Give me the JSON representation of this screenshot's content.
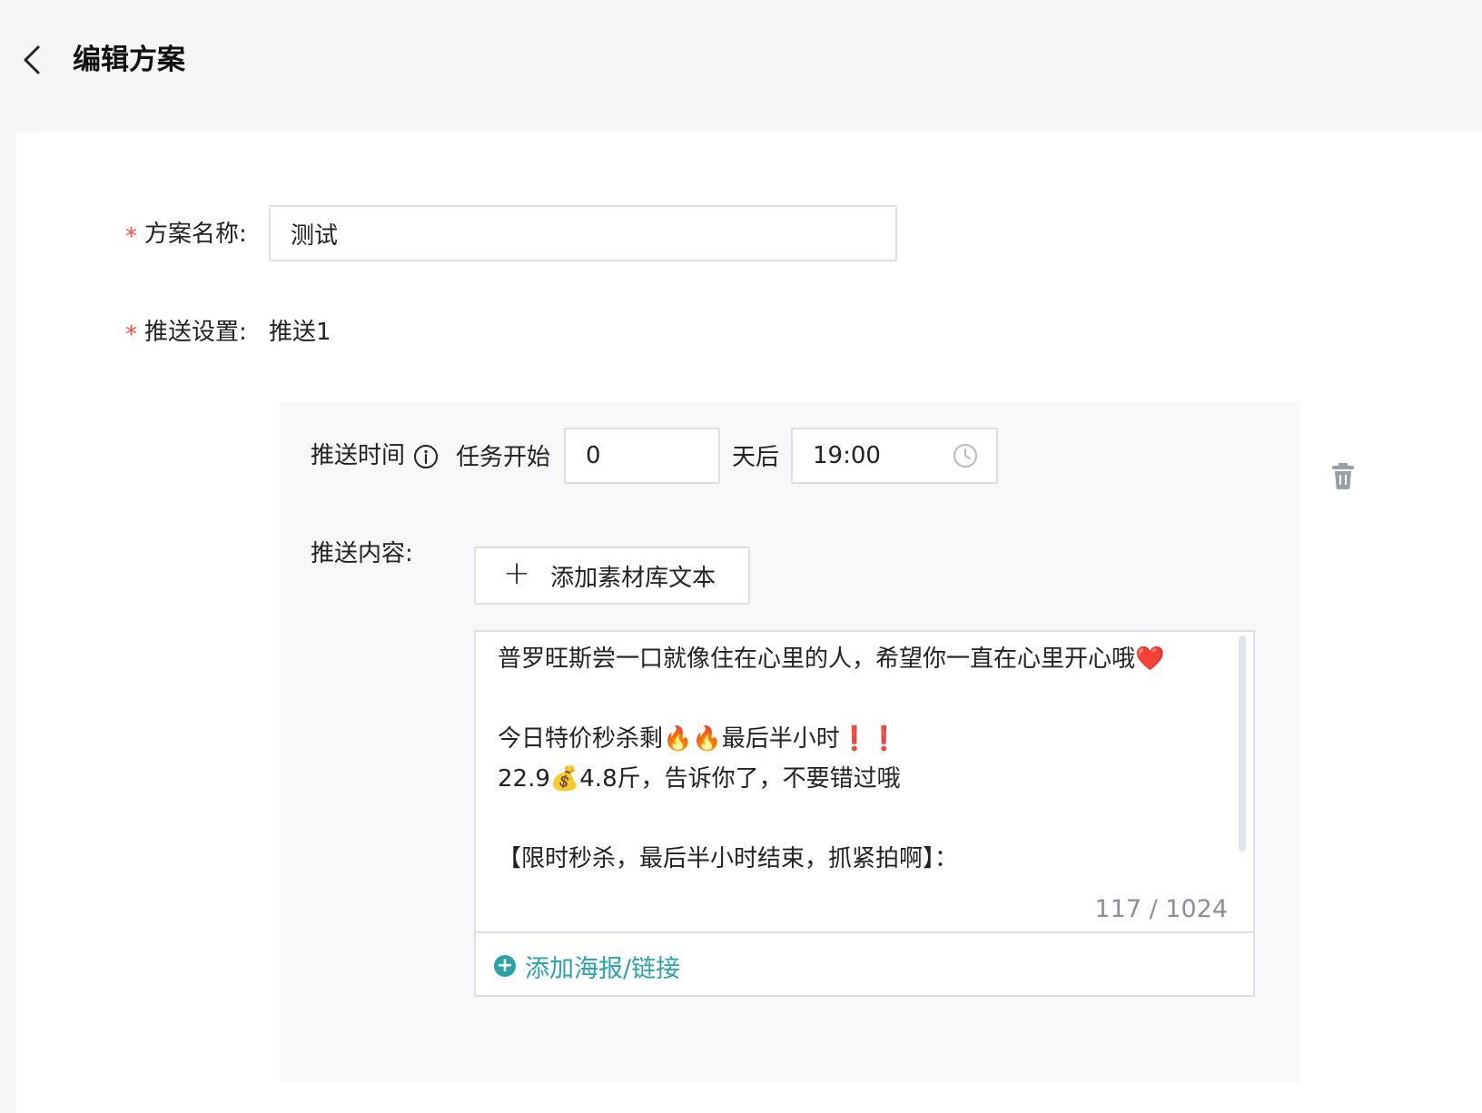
{
  "header": {
    "back_icon": "chevron-left-icon",
    "title": "编辑方案"
  },
  "form": {
    "plan_name": {
      "required_mark": "*",
      "label": "方案名称:",
      "value": "测试"
    },
    "push_settings": {
      "required_mark": "*",
      "label": "推送设置:",
      "value": "推送1"
    }
  },
  "push_item": {
    "time_label": "推送时间",
    "info_icon": "info-circle-icon",
    "task_start_text": "任务开始",
    "days_value": "0",
    "days_after_text": "天后",
    "time_value": "19:00",
    "clock_icon": "clock-icon",
    "delete_icon": "trash-icon",
    "content_label": "推送内容:",
    "add_material_label": "添加素材库文本",
    "add_material_icon": "plus-icon",
    "content_text": "普罗旺斯尝一口就像住在心里的人，希望你一直在心里开心哦❤️\n\n今日特价秒杀剩🔥🔥最后半小时❗️❗️\n22.9💰4.8斤，告诉你了，不要错过哦\n\n【限时秒杀，最后半小时结束，抓紧拍啊】：",
    "char_count": "117 / 1024",
    "add_poster_label": "添加海报/链接",
    "add_poster_icon": "plus-circle-icon"
  },
  "colors": {
    "accent": "#2aa3a7",
    "required": "#f5533d",
    "border": "#dcdfe6",
    "panel_bg": "#f7f8fa",
    "page_bg": "#f5f6f8"
  }
}
